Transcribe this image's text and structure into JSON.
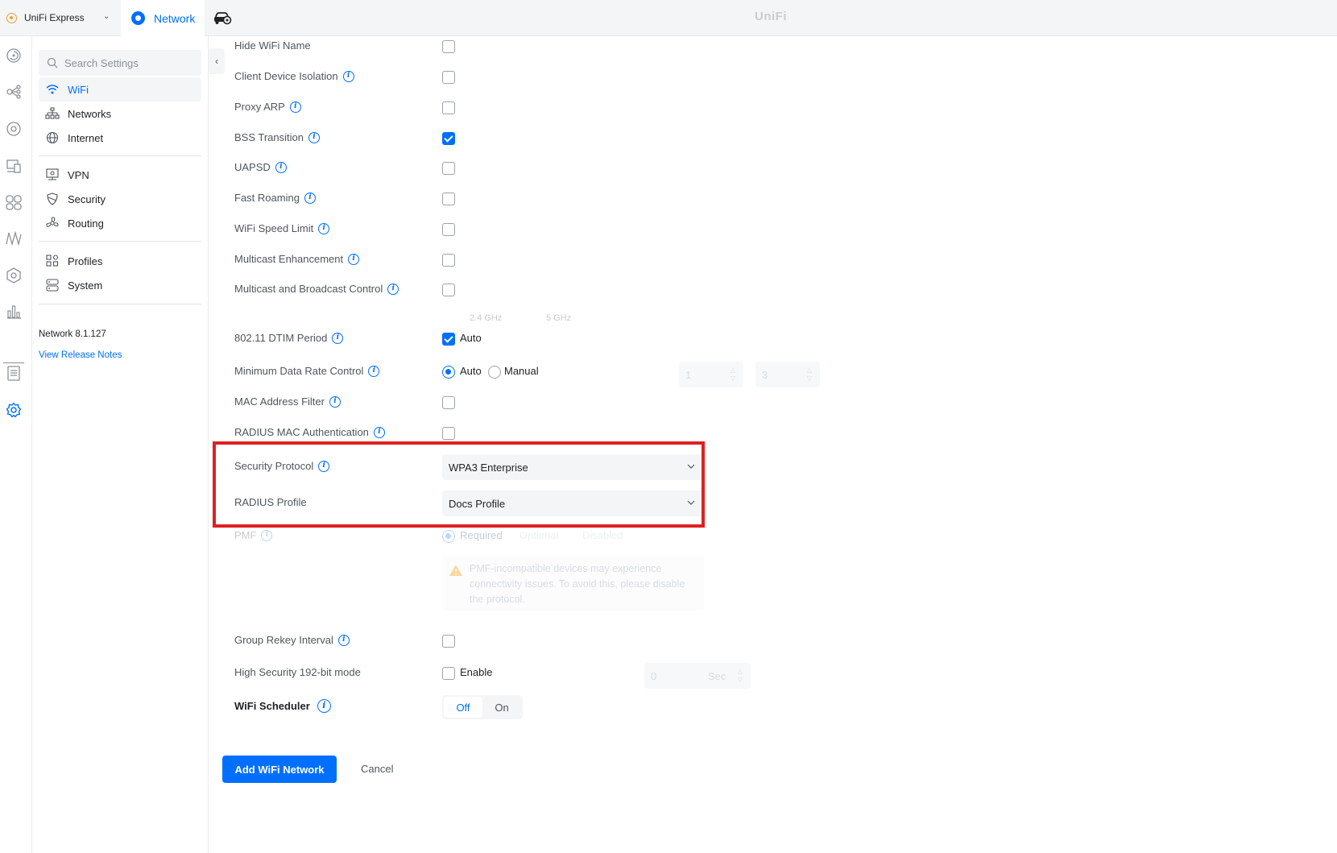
{
  "topbar": {
    "console_name": "UniFi Express",
    "app_tab": "Network",
    "brand": "UniFi"
  },
  "sidebar": {
    "search_placeholder": "Search Settings",
    "items": [
      {
        "label": "WiFi",
        "icon": "wifi-icon",
        "active": true
      },
      {
        "label": "Networks",
        "icon": "network-tree-icon"
      },
      {
        "label": "Internet",
        "icon": "globe-icon"
      },
      {
        "label": "VPN",
        "icon": "vpn-icon"
      },
      {
        "label": "Security",
        "icon": "shield-icon"
      },
      {
        "label": "Routing",
        "icon": "routing-icon"
      },
      {
        "label": "Profiles",
        "icon": "profiles-icon"
      },
      {
        "label": "System",
        "icon": "system-icon"
      }
    ],
    "version": "Network 8.1.127",
    "release_notes": "View Release Notes"
  },
  "form": {
    "hide_wifi_name": {
      "label": "Hide WiFi Name",
      "checked": false
    },
    "client_device_isolation": {
      "label": "Client Device Isolation",
      "checked": false
    },
    "proxy_arp": {
      "label": "Proxy ARP",
      "checked": false
    },
    "bss_transition": {
      "label": "BSS Transition",
      "checked": true
    },
    "uapsd": {
      "label": "UAPSD",
      "checked": false
    },
    "fast_roaming": {
      "label": "Fast Roaming",
      "checked": false
    },
    "wifi_speed_limit": {
      "label": "WiFi Speed Limit",
      "checked": false
    },
    "multicast_enhancement": {
      "label": "Multicast Enhancement",
      "checked": false
    },
    "multicast_broadcast_control": {
      "label": "Multicast and Broadcast Control",
      "checked": false
    },
    "dtim": {
      "label": "802.11 DTIM Period",
      "auto_label": "Auto",
      "auto": true,
      "band_24_label": "2.4 GHz",
      "band_24_value": "1",
      "band_5_label": "5 GHz",
      "band_5_value": "3"
    },
    "min_data_rate": {
      "label": "Minimum Data Rate Control",
      "auto_label": "Auto",
      "manual_label": "Manual",
      "selected": "Auto"
    },
    "mac_filter": {
      "label": "MAC Address Filter",
      "checked": false
    },
    "radius_mac_auth": {
      "label": "RADIUS MAC Authentication",
      "checked": false
    },
    "security_protocol": {
      "label": "Security Protocol",
      "value": "WPA3 Enterprise"
    },
    "radius_profile": {
      "label": "RADIUS Profile",
      "value": "Docs Profile"
    },
    "pmf": {
      "label": "PMF",
      "required": "Required",
      "optional": "Optional",
      "disabled": "Disabled",
      "warning": "PMF-incompatible devices may experience connectivity issues. To avoid this, please disable the protocol."
    },
    "group_rekey": {
      "label": "Group Rekey Interval",
      "value": "0",
      "unit": "Sec",
      "checked": false
    },
    "high_security": {
      "label": "High Security 192-bit mode",
      "enable_label": "Enable",
      "checked": false
    },
    "wifi_scheduler": {
      "label": "WiFi Scheduler",
      "off": "Off",
      "on": "On",
      "selected": "Off"
    }
  },
  "actions": {
    "add": "Add WiFi Network",
    "cancel": "Cancel"
  },
  "colors": {
    "accent": "#006fff",
    "highlight": "#e02020"
  }
}
